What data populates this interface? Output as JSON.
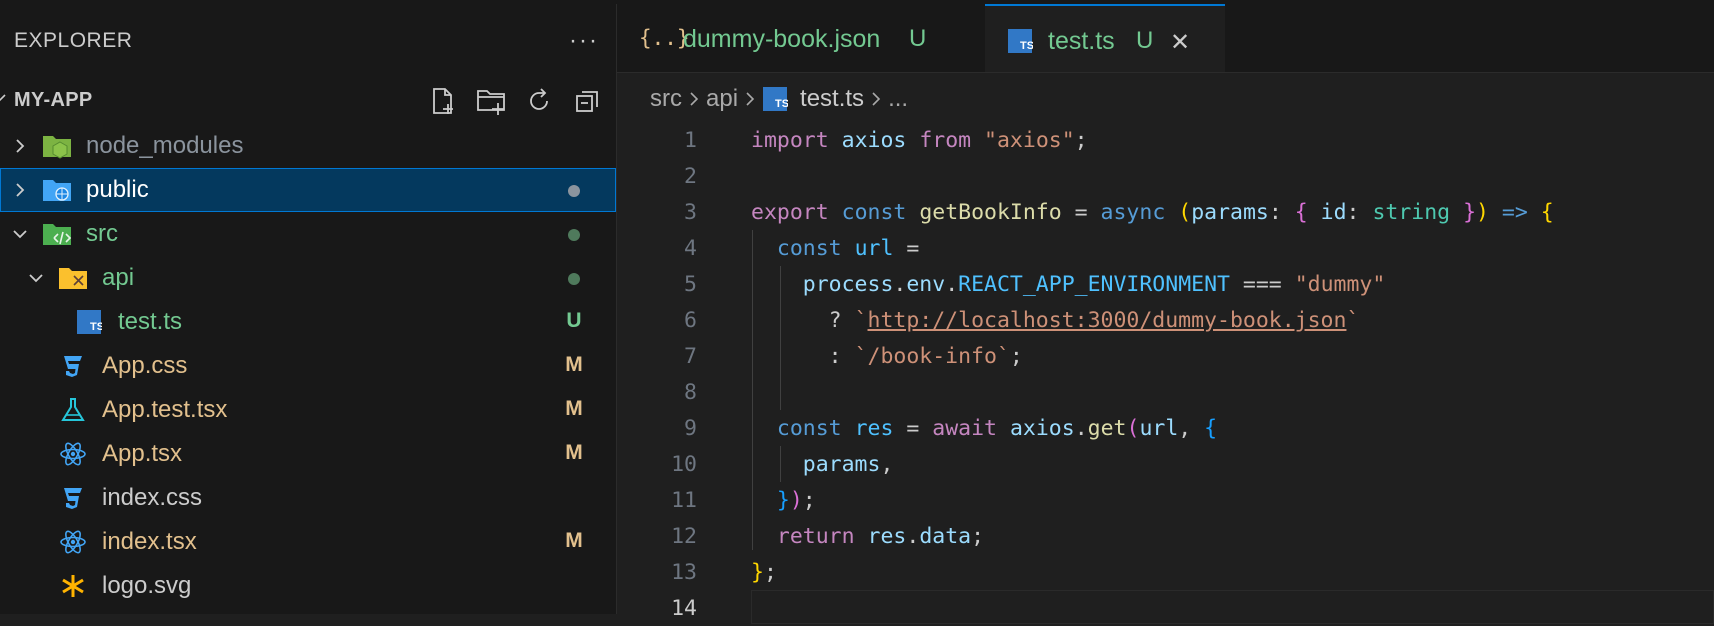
{
  "sidebar": {
    "title": "EXPLORER",
    "more": "···",
    "section": "MY-APP",
    "items": [
      {
        "label": "node_modules",
        "status": "",
        "color": "#8b949e"
      },
      {
        "label": "public",
        "status": "",
        "color": "#ffffff"
      },
      {
        "label": "src",
        "status": "",
        "color": "#73c991"
      },
      {
        "label": "api",
        "status": "",
        "color": "#73c991"
      },
      {
        "label": "test.ts",
        "status": "U",
        "color": "#73c991"
      },
      {
        "label": "App.css",
        "status": "M",
        "color": "#e2c08d"
      },
      {
        "label": "App.test.tsx",
        "status": "M",
        "color": "#e2c08d"
      },
      {
        "label": "App.tsx",
        "status": "M",
        "color": "#e2c08d"
      },
      {
        "label": "index.css",
        "status": "",
        "color": "#cccccc"
      },
      {
        "label": "index.tsx",
        "status": "M",
        "color": "#e2c08d"
      },
      {
        "label": "logo.svg",
        "status": "",
        "color": "#cccccc"
      }
    ]
  },
  "tabs": [
    {
      "icon": "{..}",
      "label": "dummy-book.json",
      "status": "U"
    },
    {
      "icon": "TS",
      "label": "test.ts",
      "status": "U",
      "close": "✕"
    }
  ],
  "breadcrumb": {
    "parts": [
      "src",
      "api",
      "test.ts",
      "..."
    ]
  },
  "code": {
    "line_numbers": [
      "1",
      "2",
      "3",
      "4",
      "5",
      "6",
      "7",
      "8",
      "9",
      "10",
      "11",
      "12",
      "13",
      "14"
    ],
    "lines": [
      "import axios from \"axios\";",
      "",
      "export const getBookInfo = async (params: { id: string }) => {",
      "const url =",
      "process.env.REACT_APP_ENVIRONMENT === \"dummy\"",
      "? `http://localhost:3000/dummy-book.json`",
      ": `/book-info`;",
      "",
      "const res = await axios.get(url, {",
      "params,",
      "});",
      "return res.data;",
      "};",
      ""
    ]
  }
}
